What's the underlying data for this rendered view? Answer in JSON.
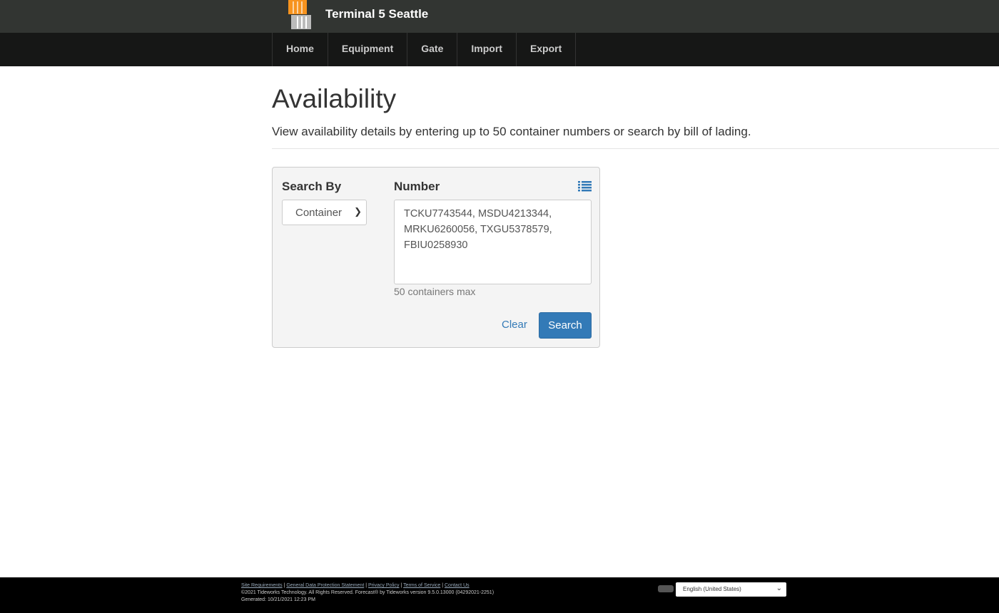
{
  "header": {
    "title": "Terminal 5 Seattle"
  },
  "nav": [
    {
      "label": "Home"
    },
    {
      "label": "Equipment"
    },
    {
      "label": "Gate"
    },
    {
      "label": "Import"
    },
    {
      "label": "Export"
    }
  ],
  "page": {
    "title": "Availability",
    "description": "View availability details by entering up to 50 container numbers or search by bill of lading."
  },
  "form": {
    "search_by_label": "Search By",
    "search_by_value": "Container",
    "number_label": "Number",
    "number_value": "TCKU7743544, MSDU4213344,\nMRKU6260056, TXGU5378579,\nFBIU0258930",
    "help": "50 containers max",
    "clear": "Clear",
    "search": "Search"
  },
  "footer": {
    "links": [
      "Site Requirements",
      "General Data Protection Statement",
      "Privacy Policy",
      "Terms of Service",
      "Contact Us"
    ],
    "copyright": "©2021 Tideworks Technology. All Rights Reserved. Forecast® by Tideworks version 9.5.0.13000 (04292021-2251)",
    "generated": "Generated: 10/21/2021 12:23 PM",
    "language": "English (United States)"
  },
  "colors": {
    "accent": "#337ab7",
    "header_bg": "#323532",
    "nav_bg": "#161716",
    "logo_orange": "#f7931e"
  }
}
